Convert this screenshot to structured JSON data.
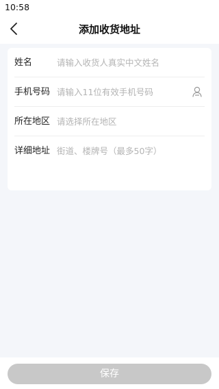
{
  "status_bar": {
    "time": "10:58"
  },
  "header": {
    "title": "添加收货地址",
    "back_icon": "chevron-left-icon"
  },
  "form": {
    "name": {
      "label": "姓名",
      "value": "",
      "placeholder": "请输入收货人真实中文姓名"
    },
    "phone": {
      "label": "手机号码",
      "value": "",
      "placeholder": "请输入11位有效手机号码",
      "icon": "contact-person-icon"
    },
    "region": {
      "label": "所在地区",
      "value": "",
      "placeholder": "请选择所在地区"
    },
    "detail": {
      "label": "详细地址",
      "value": "",
      "placeholder": "街道、楼牌号（最多50字）"
    }
  },
  "footer": {
    "save_label": "保存"
  },
  "colors": {
    "background": "#f4f6fa",
    "card": "#ffffff",
    "placeholder": "#b4b4b4",
    "save_button_disabled": "#c8c8c8"
  }
}
